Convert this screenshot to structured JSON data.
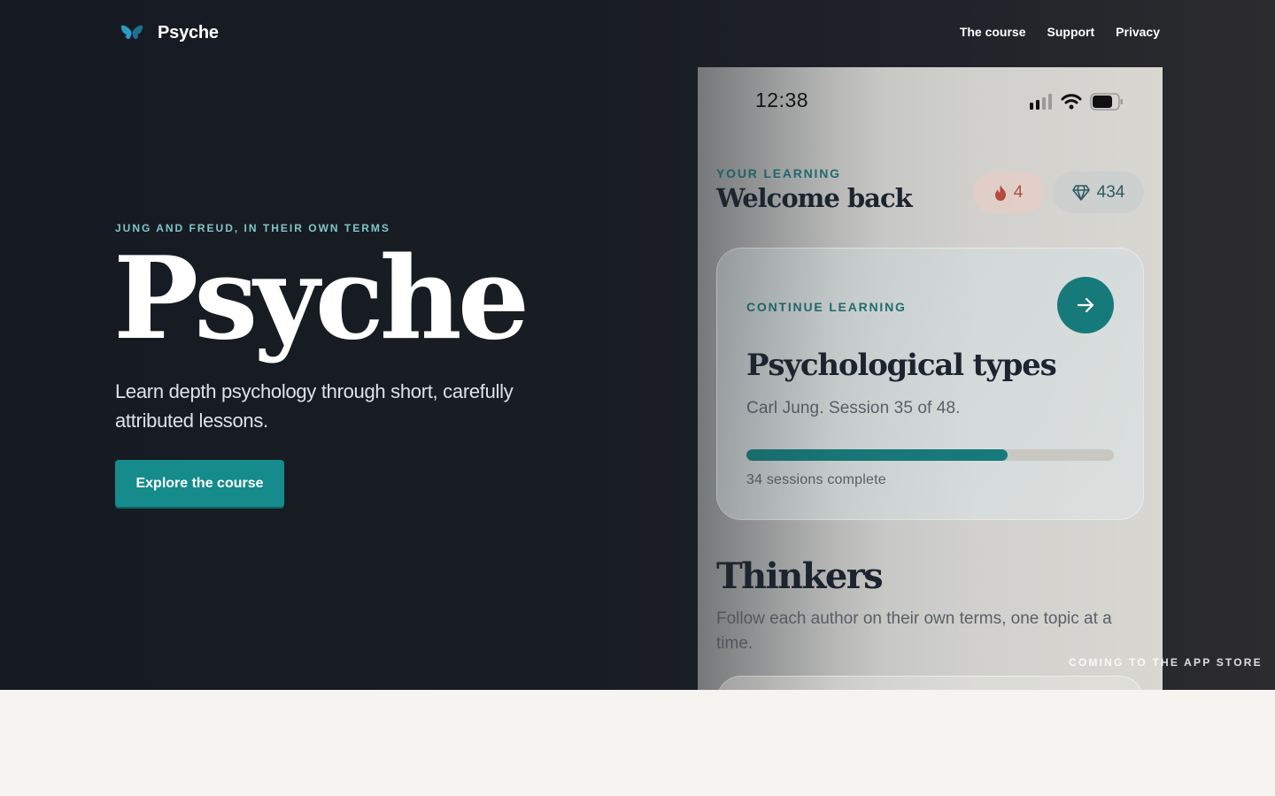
{
  "header": {
    "brand": "Psyche",
    "nav": [
      "The course",
      "Support",
      "Privacy"
    ]
  },
  "hero": {
    "eyebrow": "JUNG AND FREUD, IN THEIR OWN TERMS",
    "title": "Psyche",
    "subtitle": "Learn depth psychology through short, carefully attributed lessons.",
    "cta": "Explore the course"
  },
  "phone": {
    "status": {
      "time": "12:38"
    },
    "eyebrow": "YOUR LEARNING",
    "welcome": "Welcome back",
    "streak": "4",
    "gems": "434",
    "card": {
      "eyebrow": "CONTINUE LEARNING",
      "title": "Psychological types",
      "subtitle": "Carl Jung. Session 35 of 48.",
      "progress_fraction": 0.71,
      "progress_label": "34 sessions complete"
    },
    "thinkers": {
      "title": "Thinkers",
      "subtitle": "Follow each author on their own terms, one topic at a time."
    }
  },
  "store_note": "COMING TO THE APP STORE",
  "colors": {
    "accent": "#168b8c",
    "hero_bg": "#161b23",
    "eyebrow": "#7fc6c9",
    "streak": "#b54a3a",
    "gems": "#2e5a62"
  },
  "icons": [
    "butterfly-logo-icon",
    "signal-icon",
    "wifi-icon",
    "battery-icon",
    "flame-icon",
    "diamond-icon",
    "arrow-right-icon"
  ]
}
